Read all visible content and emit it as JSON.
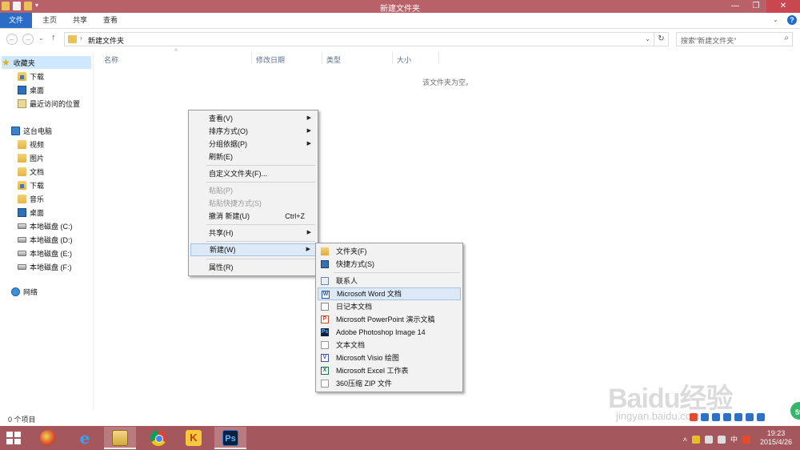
{
  "window": {
    "title": "新建文件夹",
    "buttons": {
      "minimize": "—",
      "restore": "❐",
      "close": "✕"
    }
  },
  "ribbon": {
    "tabs": [
      "文件",
      "主页",
      "共享",
      "查看"
    ],
    "help": "?"
  },
  "address": {
    "path": "新建文件夹",
    "search_placeholder": "搜索\"新建文件夹\""
  },
  "nav": {
    "favorites_label": "收藏夹",
    "favorites": [
      "下载",
      "桌面",
      "最近访问的位置"
    ],
    "pc_label": "这台电脑",
    "pc_items": [
      "视频",
      "图片",
      "文档",
      "下载",
      "音乐",
      "桌面",
      "本地磁盘 (C:)",
      "本地磁盘 (D:)",
      "本地磁盘 (E:)",
      "本地磁盘 (F:)"
    ],
    "network_label": "网络"
  },
  "columns": [
    "名称",
    "修改日期",
    "类型",
    "大小"
  ],
  "empty_message": "该文件夹为空。",
  "status": {
    "items": "0 个项目"
  },
  "context_menu": {
    "items": [
      {
        "label": "查看(V)",
        "submenu": true
      },
      {
        "label": "排序方式(O)",
        "submenu": true
      },
      {
        "label": "分组依据(P)",
        "submenu": true
      },
      {
        "label": "刷新(E)"
      },
      {
        "label": "自定义文件夹(F)..."
      },
      {
        "label": "粘贴(P)",
        "disabled": true
      },
      {
        "label": "粘贴快捷方式(S)",
        "disabled": true
      },
      {
        "label": "撤消 新建(U)",
        "shortcut": "Ctrl+Z"
      },
      {
        "label": "共享(H)",
        "submenu": true
      },
      {
        "label": "新建(W)",
        "submenu": true,
        "highlighted": true
      },
      {
        "label": "属性(R)"
      }
    ]
  },
  "new_submenu": {
    "items": [
      {
        "label": "文件夹(F)",
        "icon": "folder-icon"
      },
      {
        "label": "快捷方式(S)",
        "icon": "shortcut-icon"
      },
      {
        "label": "联系人",
        "icon": "contact-icon"
      },
      {
        "label": "Microsoft Word 文档",
        "icon": "word-icon",
        "highlighted": true
      },
      {
        "label": "日记本文档",
        "icon": "journal-icon"
      },
      {
        "label": "Microsoft PowerPoint 演示文稿",
        "icon": "powerpoint-icon"
      },
      {
        "label": "Adobe Photoshop Image 14",
        "icon": "photoshop-icon"
      },
      {
        "label": "文本文档",
        "icon": "text-document-icon"
      },
      {
        "label": "Microsoft Visio 绘图",
        "icon": "visio-icon"
      },
      {
        "label": "Microsoft Excel 工作表",
        "icon": "excel-icon"
      },
      {
        "label": "360压缩 ZIP 文件",
        "icon": "zip-icon"
      }
    ]
  },
  "taskbar": {
    "apps": [
      "360-icon",
      "internet-explorer-icon",
      "file-explorer-icon",
      "chrome-icon",
      "kingsoft-icon",
      "photoshop-icon"
    ],
    "tray_ime": "中",
    "time": "19:23",
    "date": "2015/4/26"
  },
  "watermark": {
    "logo": "Baidu经验",
    "url": "jingyan.baidu.com"
  },
  "badge": "59"
}
